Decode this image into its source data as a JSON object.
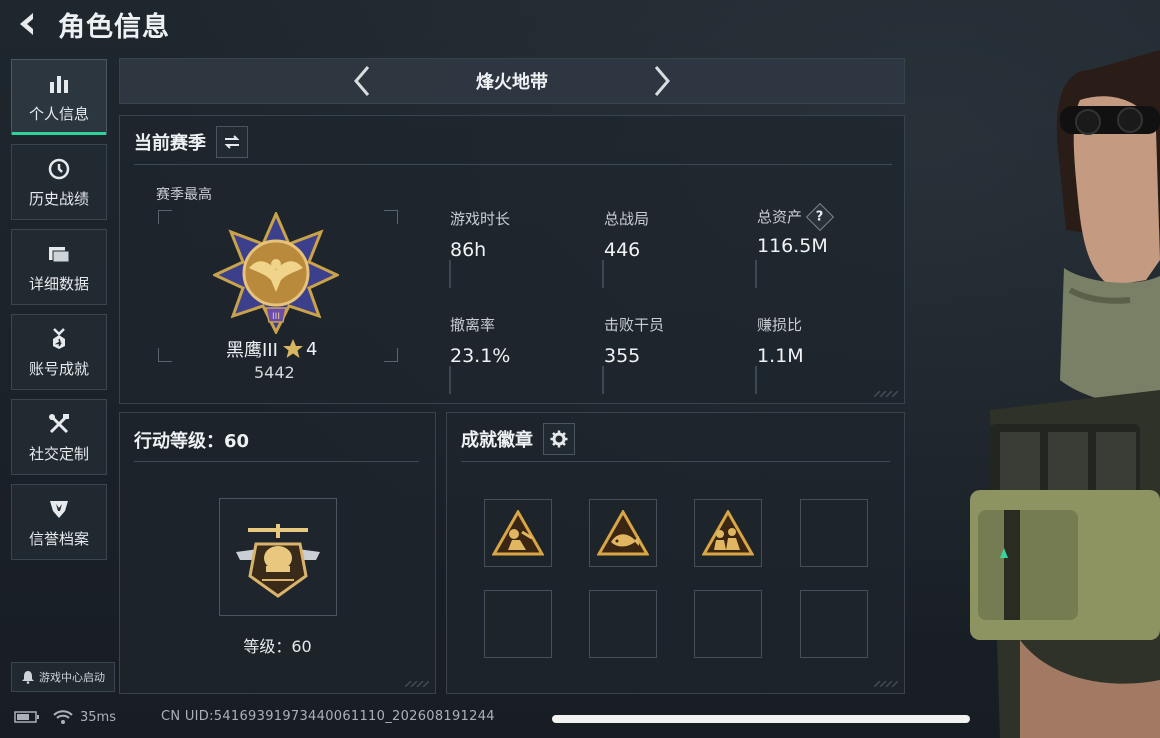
{
  "header": {
    "title": "角色信息",
    "back_icon": "back-arrow-icon"
  },
  "sidebar": {
    "items": [
      {
        "label": "个人信息",
        "icon": "bar-chart-icon",
        "active": true
      },
      {
        "label": "历史战绩",
        "icon": "history-clock-icon",
        "active": false
      },
      {
        "label": "详细数据",
        "icon": "folder-icon",
        "active": false
      },
      {
        "label": "账号成就",
        "icon": "achievement-medal-icon",
        "active": false
      },
      {
        "label": "社交定制",
        "icon": "tools-icon",
        "active": false
      },
      {
        "label": "信誉档案",
        "icon": "credit-shield-icon",
        "active": false
      }
    ],
    "launch_label": "游戏中心启动"
  },
  "mode": {
    "title": "烽火地带"
  },
  "season": {
    "title": "当前赛季",
    "best_label": "赛季最高",
    "rank_name": "黑鹰III",
    "rank_stars": "4",
    "rank_score": "5442",
    "stats": [
      {
        "label": "游戏时长",
        "value": "86h"
      },
      {
        "label": "总战局",
        "value": "446"
      },
      {
        "label": "总资产",
        "value": "116.5M",
        "help": "?"
      },
      {
        "label": "撤离率",
        "value": "23.1%"
      },
      {
        "label": "击败干员",
        "value": "355"
      },
      {
        "label": "赚损比",
        "value": "1.1M"
      }
    ]
  },
  "action_level": {
    "title": "行动等级：60",
    "level_text": "等级：60"
  },
  "badges": {
    "title": "成就徽章",
    "slots_filled": 3,
    "slots_total": 8
  },
  "footer": {
    "ping": "35ms",
    "uid": "CN UID:54169391973440061110_202608191244"
  },
  "colors": {
    "accent": "#2fd39a",
    "gold": "#c9a24a",
    "background": "#1b2229"
  }
}
